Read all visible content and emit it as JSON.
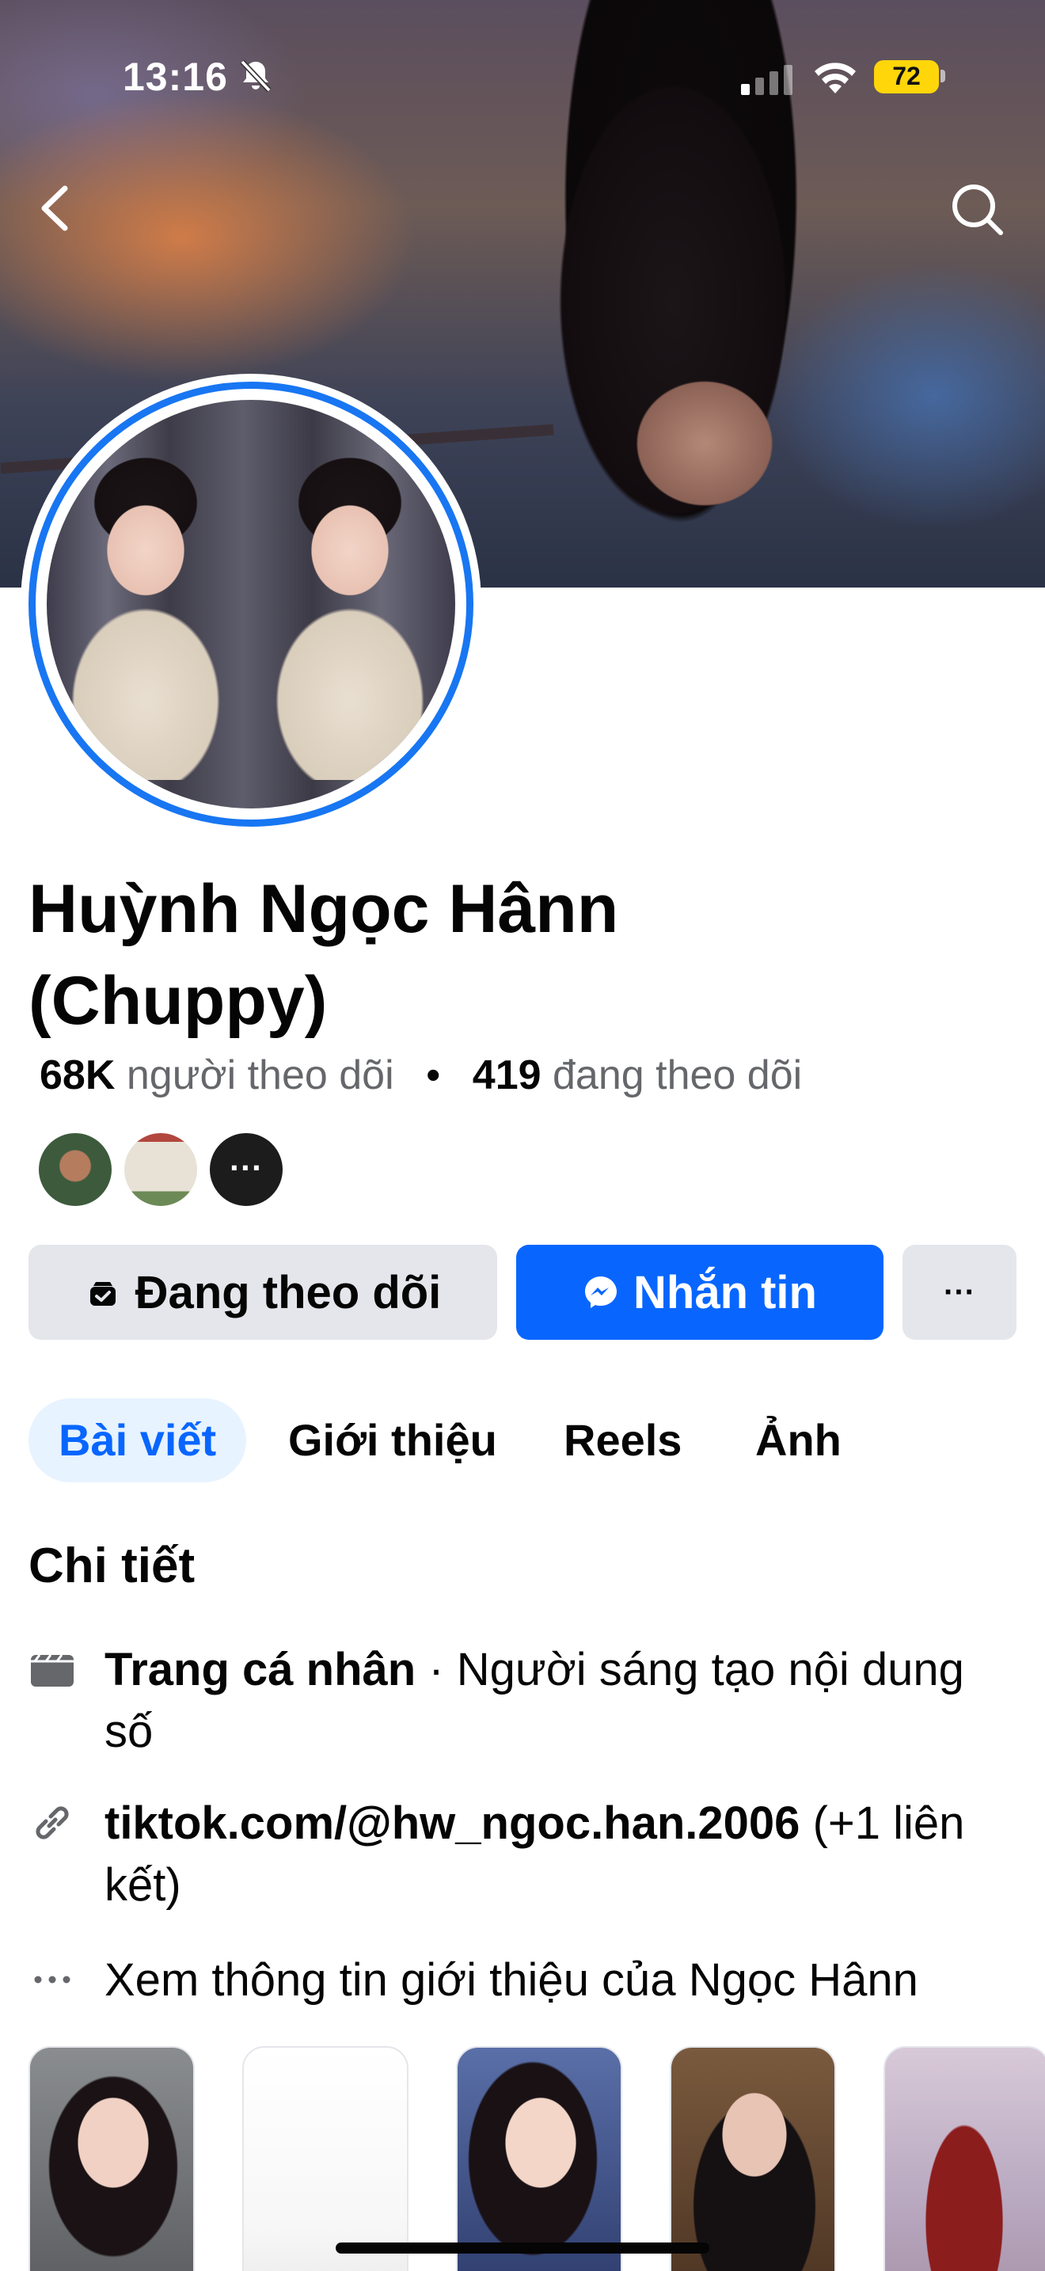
{
  "status_bar": {
    "time": "13:16",
    "battery": "72",
    "icons": [
      "bell-slash-icon",
      "cellular-signal-icon",
      "wifi-icon",
      "battery-icon"
    ]
  },
  "navigation": {
    "back_icon": "chevron-left-icon",
    "search_icon": "search-icon"
  },
  "profile": {
    "name": "Huỳnh Ngọc Hânn (Chuppy)",
    "followers_count": "68K",
    "followers_label": "người theo dõi",
    "separator": "•",
    "following_count": "419",
    "following_label": "đang theo dõi",
    "mutual_more": "···"
  },
  "actions": {
    "follow_label": "Đang theo dõi",
    "message_label": "Nhắn tin",
    "more_label": "···"
  },
  "tabs": [
    {
      "label": "Bài viết",
      "active": true
    },
    {
      "label": "Giới thiệu",
      "active": false
    },
    {
      "label": "Reels",
      "active": false
    },
    {
      "label": "Ảnh",
      "active": false
    }
  ],
  "details": {
    "title": "Chi tiết",
    "page_type_bold": "Trang cá nhân",
    "page_type_rest": " · Người sáng tạo nội dung số",
    "link_bold": "tiktok.com/@hw_ngoc.han.2006",
    "link_rest": " (+1 liên kết)",
    "see_about": "Xem thông tin giới thiệu của Ngọc Hânn"
  },
  "colors": {
    "accent": "#0866ff",
    "ring": "#1876f2",
    "button_gray": "#e4e6eb",
    "tab_active_bg": "#e7f3ff",
    "battery": "#ffd60a"
  }
}
